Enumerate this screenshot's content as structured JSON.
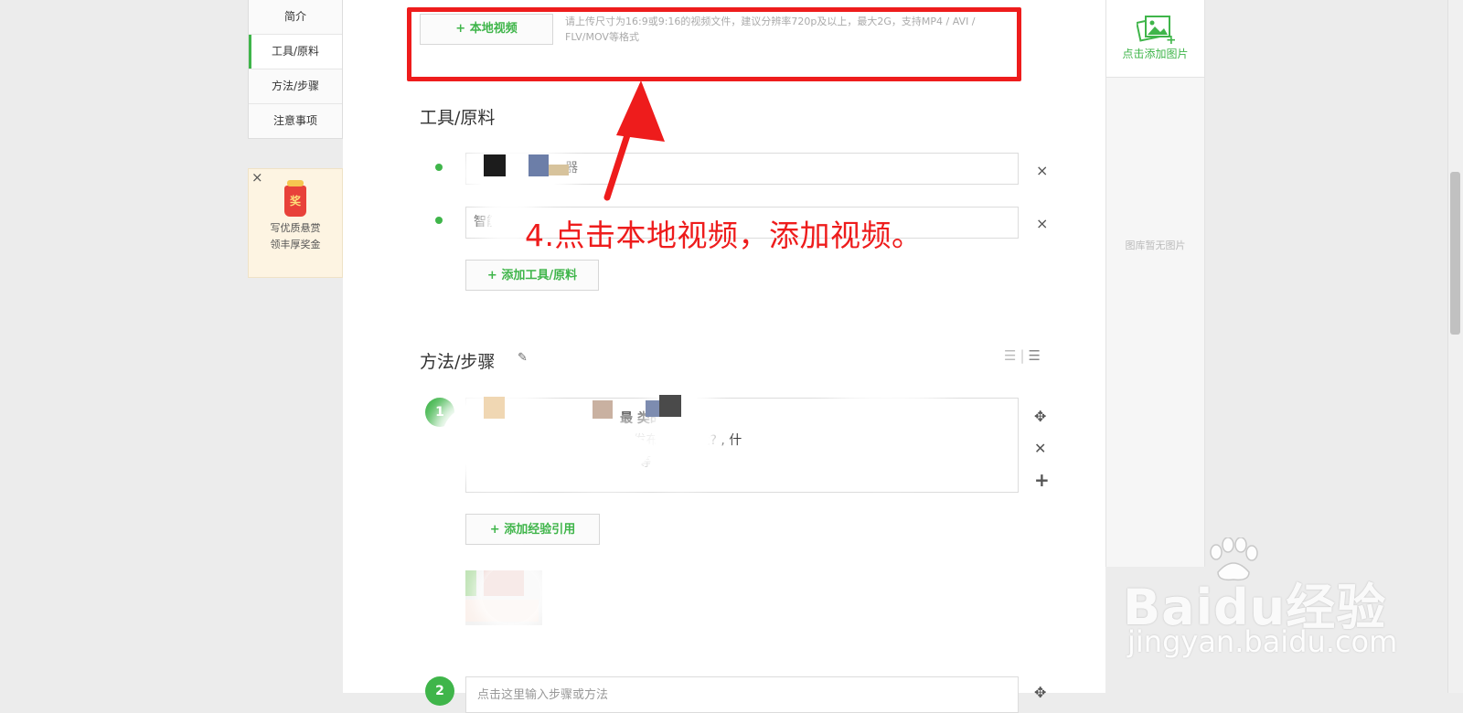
{
  "nav": {
    "items": [
      {
        "label": "简介",
        "active": false
      },
      {
        "label": "工具/原料",
        "active": true
      },
      {
        "label": "方法/步骤",
        "active": false
      },
      {
        "label": "注意事项",
        "active": false
      }
    ]
  },
  "reward": {
    "badge": "奖",
    "line1": "写优质悬赏",
    "line2": "领丰厚奖金"
  },
  "video": {
    "button_label": "+ 本地视频",
    "hint": "请上传尺寸为16:9或9:16的视频文件，建议分辨率720p及以上，最大2G，支持MP4 / AVI / FLV/MOV等格式"
  },
  "tools": {
    "title": "工具/原料",
    "items": [
      {
        "value": "器"
      },
      {
        "value": "智能"
      }
    ],
    "add_label": "+ 添加工具/原料",
    "remove_glyph": "×"
  },
  "steps": {
    "title": "方法/步骤",
    "items": [
      {
        "number": "1",
        "line1": "最  类的。",
        "line2": "互        发布优质经验?                    , 什",
        "line3": "等"
      },
      {
        "number": "2",
        "placeholder": "点击这里输入步骤或方法"
      }
    ],
    "add_reference_label": "+ 添加经验引用"
  },
  "annotation": {
    "text": "4.点击本地视频，添加视频。",
    "color": "#ee1c1c"
  },
  "image_panel": {
    "add_label": "点击添加图片",
    "empty_text": "图库暂无图片"
  },
  "watermark": {
    "logo": "Baidu经验",
    "url": "jingyan.baidu.com"
  },
  "colors": {
    "accent": "#3fb54a",
    "highlight": "#ee1c1c"
  }
}
